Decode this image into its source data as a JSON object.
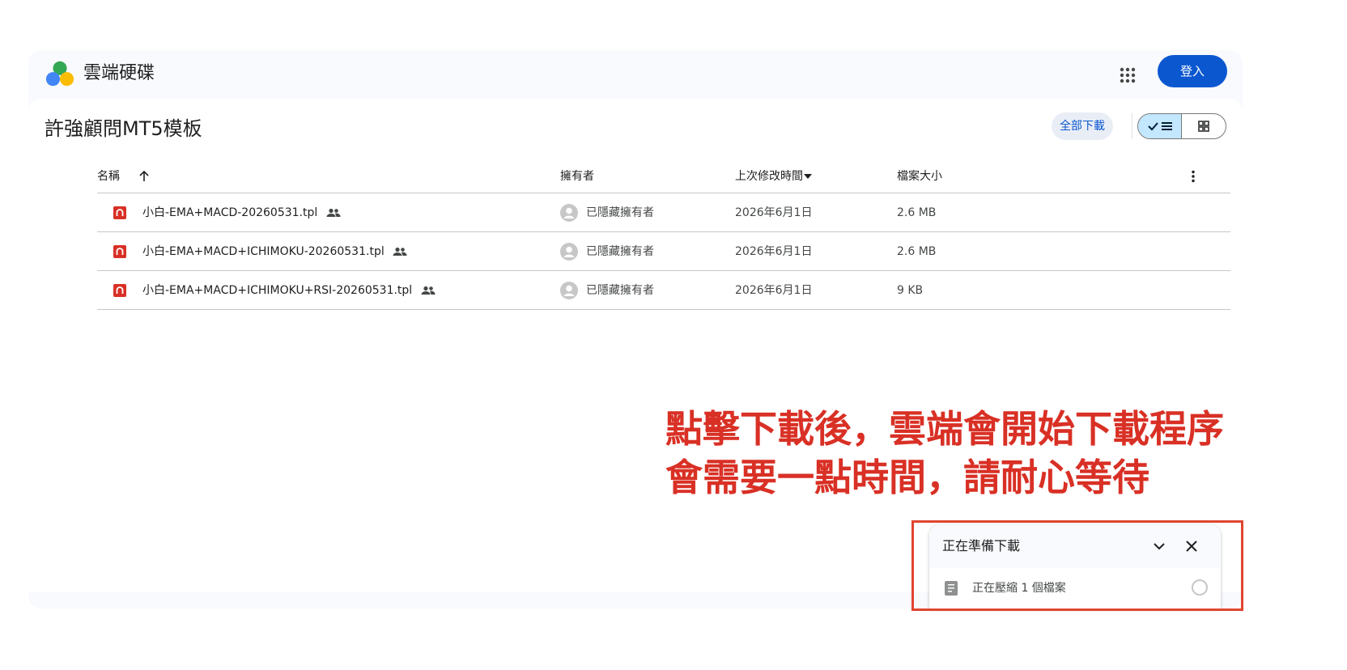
{
  "app": {
    "title": "雲端硬碟",
    "signin_label": "登入"
  },
  "folder": {
    "title": "許強顧問MT5模板",
    "download_all_label": "全部下載"
  },
  "table": {
    "headers": {
      "name": "名稱",
      "owner": "擁有者",
      "modified": "上次修改時間",
      "size": "檔案大小"
    },
    "rows": [
      {
        "name": "小白-EMA+MACD-20260531.tpl",
        "owner": "已隱藏擁有者",
        "modified": "2026年6月1日",
        "size": "2.6 MB"
      },
      {
        "name": "小白-EMA+MACD+ICHIMOKU-20260531.tpl",
        "owner": "已隱藏擁有者",
        "modified": "2026年6月1日",
        "size": "2.6 MB"
      },
      {
        "name": "小白-EMA+MACD+ICHIMOKU+RSI-20260531.tpl",
        "owner": "已隱藏擁有者",
        "modified": "2026年6月1日",
        "size": "9 KB"
      }
    ]
  },
  "annotation": {
    "line1": "點擊下載後，雲端會開始下載程序",
    "line2": "會需要一點時間，請耐心等待"
  },
  "download_panel": {
    "title": "正在準備下載",
    "item_label": "正在壓縮 1 個檔案"
  },
  "colors": {
    "accent": "#0b57d0",
    "annotation": "#d93025",
    "file_icon": "#d93025"
  }
}
